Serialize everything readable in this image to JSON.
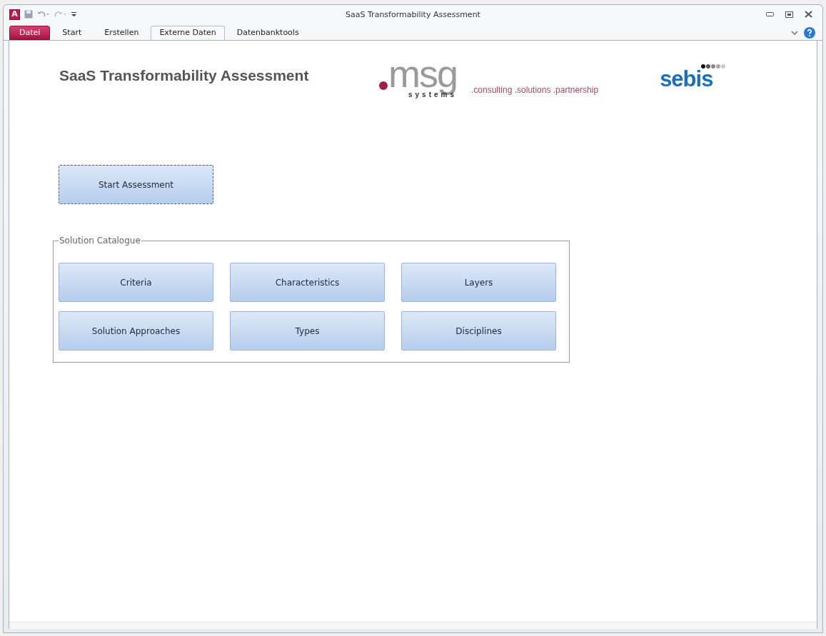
{
  "window": {
    "title": "SaaS Transformability Assessment"
  },
  "ribbon_tabs": [
    {
      "label": "Datei",
      "kind": "file",
      "selected": false
    },
    {
      "label": "Start",
      "kind": "tab",
      "selected": false
    },
    {
      "label": "Erstellen",
      "kind": "tab",
      "selected": false
    },
    {
      "label": "Externe Daten",
      "kind": "tab",
      "selected": true
    },
    {
      "label": "Datenbanktools",
      "kind": "tab",
      "selected": false
    }
  ],
  "app_icon": "A",
  "header": {
    "title": "SaaS Transformability Assessment",
    "msg_logo": {
      "word": "msg",
      "sub": "systems"
    },
    "tagline": ".consulting .solutions .partnership",
    "sebis_logo": "sebis"
  },
  "start_button": "Start Assessment",
  "catalogue": {
    "legend": "Solution Catalogue",
    "buttons": [
      "Criteria",
      "Characteristics",
      "Layers",
      "Solution Approaches",
      "Types",
      "Disciplines"
    ]
  }
}
